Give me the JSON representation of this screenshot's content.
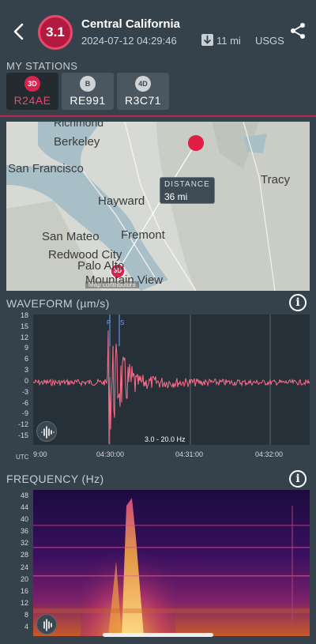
{
  "header": {
    "magnitude": "3.1",
    "title": "Central California",
    "datetime": "2024-07-12 04:29:46",
    "distance": "11 mi",
    "source": "USGS"
  },
  "stations_label": "MY STATIONS",
  "stations": [
    {
      "badge": "3D",
      "name": "R24AE",
      "selected": true,
      "badge_color": "#d9244e"
    },
    {
      "badge": "B",
      "name": "RE991",
      "selected": false,
      "badge_color": "#cfd3d6"
    },
    {
      "badge": "4D",
      "name": "R3C71",
      "selected": false,
      "badge_color": "#cfd3d6"
    }
  ],
  "map": {
    "places": [
      "Richmond",
      "Berkeley",
      "San Francisco",
      "Hayward",
      "Fremont",
      "San Mateo",
      "Redwood City",
      "Palo Alto",
      "Mountain View",
      "Tracy"
    ],
    "distance_label": "DISTANCE",
    "distance_value": "36 mi",
    "station_badge": "3D",
    "attribution": "Map contributors"
  },
  "waveform": {
    "title": "WAVEFORM (µm/s)",
    "y_ticks": [
      "18",
      "15",
      "12",
      "9",
      "6",
      "3",
      "0",
      "-3",
      "-6",
      "-9",
      "-12",
      "-15"
    ],
    "x_ticks": [
      "9:00",
      "04:30:00",
      "04:31:00",
      "04:32:00"
    ],
    "utc_label": "UTC",
    "band": "3.0 - 20.0 Hz",
    "p_label": "P",
    "s_label": "S",
    "trace_color": "#ff6d8a"
  },
  "frequency": {
    "title": "FREQUENCY (Hz)",
    "y_ticks": [
      "48",
      "44",
      "40",
      "36",
      "32",
      "28",
      "24",
      "20",
      "16",
      "12",
      "8",
      "4"
    ]
  },
  "icons": {
    "back": "chevron-left-icon",
    "share": "share-icon",
    "info": "info-icon",
    "waveform": "waveform-icon"
  }
}
